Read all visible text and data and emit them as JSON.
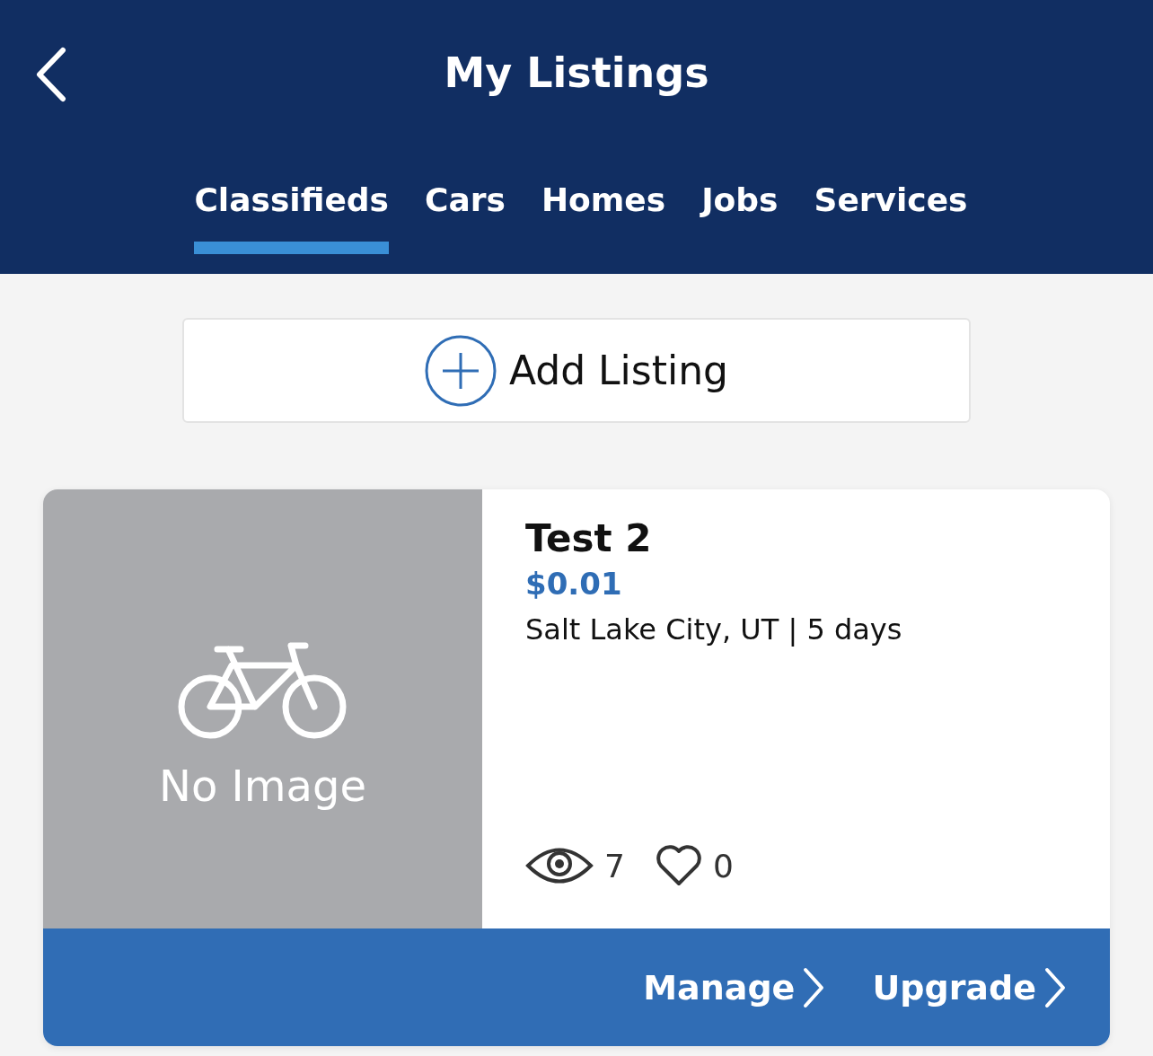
{
  "header": {
    "title": "My Listings"
  },
  "tabs": [
    {
      "label": "Classifieds",
      "selected": true
    },
    {
      "label": "Cars",
      "selected": false
    },
    {
      "label": "Homes",
      "selected": false
    },
    {
      "label": "Jobs",
      "selected": false
    },
    {
      "label": "Services",
      "selected": false
    }
  ],
  "add_button": {
    "label": "Add Listing"
  },
  "listings": [
    {
      "image_label": "No Image",
      "title": "Test 2",
      "price": "$0.01",
      "location": "Salt Lake City, UT | 5 days",
      "views": "7",
      "favorites": "0",
      "actions": [
        "Manage",
        "Upgrade"
      ]
    }
  ]
}
